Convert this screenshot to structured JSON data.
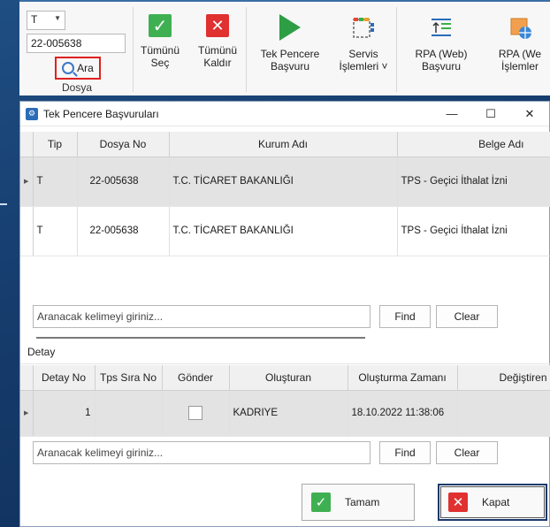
{
  "ribbon": {
    "dosya": {
      "type_value": "T",
      "doc_number": "22-005638",
      "search_label": "Ara",
      "group_label": "Dosya"
    },
    "buttons": [
      {
        "label": "Tümünü\nSeç",
        "icon": "check-icon"
      },
      {
        "label": "Tümünü\nKaldır",
        "icon": "x-icon"
      },
      {
        "label": "Tek Pencere\nBaşvuru",
        "icon": "play-icon"
      },
      {
        "label": "Servis\nİşlemleri ˅",
        "icon": "servis-icon"
      },
      {
        "label": "RPA (Web)\nBaşvuru",
        "icon": "rpa-upload-icon"
      },
      {
        "label": "RPA (We\nİşlemler",
        "icon": "rpa-globe-icon"
      }
    ]
  },
  "dialog": {
    "title": "Tek Pencere Başvuruları",
    "controls": {
      "minimize": "—",
      "maximize": "☐",
      "close": "✕"
    },
    "main_grid": {
      "columns": [
        "Tip",
        "Dosya No",
        "Kurum Adı",
        "Belge Adı"
      ],
      "rows": [
        {
          "tip": "T",
          "dosya_no": "22-005638",
          "kurum": "T.C. TİCARET BAKANLIĞI",
          "belge": "TPS - Geçici İthalat İzni",
          "selected": true
        },
        {
          "tip": "T",
          "dosya_no": "22-005638",
          "kurum": "T.C. TİCARET BAKANLIĞI",
          "belge": "TPS - Geçici İthalat İzni",
          "selected": false
        }
      ]
    },
    "search_top": {
      "placeholder": "Aranacak kelimeyi giriniz...",
      "find": "Find",
      "clear": "Clear"
    },
    "detay": {
      "label": "Detay",
      "columns": [
        "Detay No",
        "Tps Sıra No",
        "Gönder",
        "Oluşturan",
        "Oluşturma Zamanı",
        "Değiştiren"
      ],
      "rows": [
        {
          "detay_no": "1",
          "tps_sira_no": "",
          "gonder": false,
          "olusturan": "KADRIYE",
          "olusturma_zamani": "18.10.2022 11:38:06",
          "degistiren": ""
        }
      ]
    },
    "search_bottom": {
      "placeholder": "Aranacak kelimeyi giriniz...",
      "find": "Find",
      "clear": "Clear"
    },
    "footer": {
      "ok": "Tamam",
      "cancel": "Kapat"
    }
  },
  "colors": {
    "accent_green": "#3fb052",
    "accent_red": "#e03030",
    "focus_red": "#e02020",
    "desktop_blue": "#1f4e83"
  }
}
